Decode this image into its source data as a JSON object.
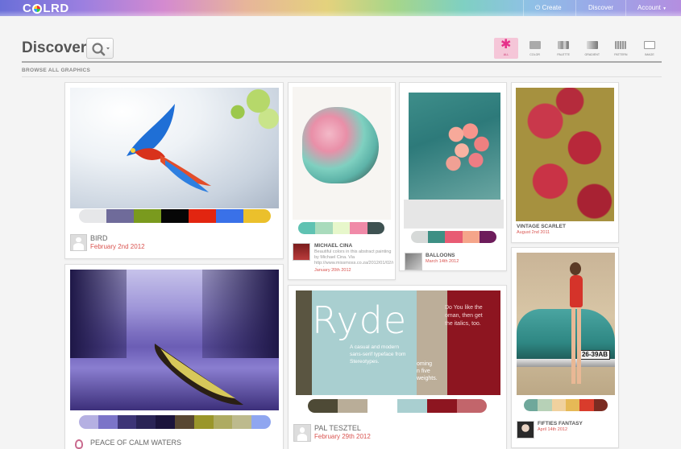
{
  "topbar": {
    "logo": {
      "pre": "C",
      "post": "LRD"
    },
    "nav": {
      "create": "Create",
      "discover": "Discover",
      "account": "Account"
    }
  },
  "header": {
    "title": "Discover",
    "browse_label": "BROWSE ALL GRAPHICS"
  },
  "filters": [
    {
      "label": "ALL",
      "active": true,
      "icon": "asterisk-icon"
    },
    {
      "label": "COLOR",
      "active": false,
      "icon": "color-icon"
    },
    {
      "label": "PALETTE",
      "active": false,
      "icon": "palette-icon"
    },
    {
      "label": "GRADIENT",
      "active": false,
      "icon": "gradient-icon"
    },
    {
      "label": "PATTERN",
      "active": false,
      "icon": "pattern-icon"
    },
    {
      "label": "IMAGE",
      "active": false,
      "icon": "image-icon"
    }
  ],
  "cards": {
    "bird": {
      "name": "BIRD",
      "date": "February 2nd 2012",
      "palette": [
        "#e6e7e9",
        "#6f6b9a",
        "#7a9a1e",
        "#060606",
        "#e22510",
        "#3a71e8",
        "#ebc02c"
      ]
    },
    "calm": {
      "name": "PEACE OF CALM WATERS",
      "palette": [
        "#b5b0e2",
        "#7b74c8",
        "#3d3577",
        "#2a2456",
        "#1b143c",
        "#584732",
        "#9a962a",
        "#aeab62",
        "#bdba8d",
        "#8fa6f0"
      ]
    },
    "cina": {
      "name": "MICHAEL CINA",
      "desc": "Beautiful colors in this abstract painting by Michael Cina. Via http://www.missmoss.co.za/2012/01/02/michael-cina/",
      "date": "January 20th 2012",
      "palette": [
        "#5fc2b2",
        "#a9dbbc",
        "#e7f7cb",
        "#f08aa8",
        "#3e5252"
      ]
    },
    "balloons": {
      "name": "BALLOONS",
      "date": "March 14th 2012",
      "palette": [
        "#d6d9d8",
        "#3d8f84",
        "#e85b73",
        "#f5a58a",
        "#6d1c5b"
      ]
    },
    "ryde": {
      "name": "PAL TESZTEL",
      "date": "February 29th 2012",
      "palette": [
        "#4e4a36",
        "#b9ad98",
        "#ffffff",
        "#a9cfd0",
        "#8d1520",
        "#c2656b"
      ],
      "poster": {
        "word": "Ryde",
        "desc": "A casual and modern sans-serif typeface from Stereotypes.",
        "coming": "oming",
        "five": "n five",
        "weights": "weights.",
        "side1": "Do You like the",
        "side2": "oman, then get",
        "side3": "the italics, too."
      }
    },
    "scarlet": {
      "name": "VINTAGE SCARLET",
      "date": "August 2nd 2011"
    },
    "fifties": {
      "name": "FIFTIES FANTASY",
      "date": "April 14th 2012",
      "palette": [
        "#6fa89b",
        "#b7d1b7",
        "#f0d19e",
        "#e6b956",
        "#d93c2c",
        "#7b2c22"
      ],
      "plate": "26-39AB"
    }
  }
}
